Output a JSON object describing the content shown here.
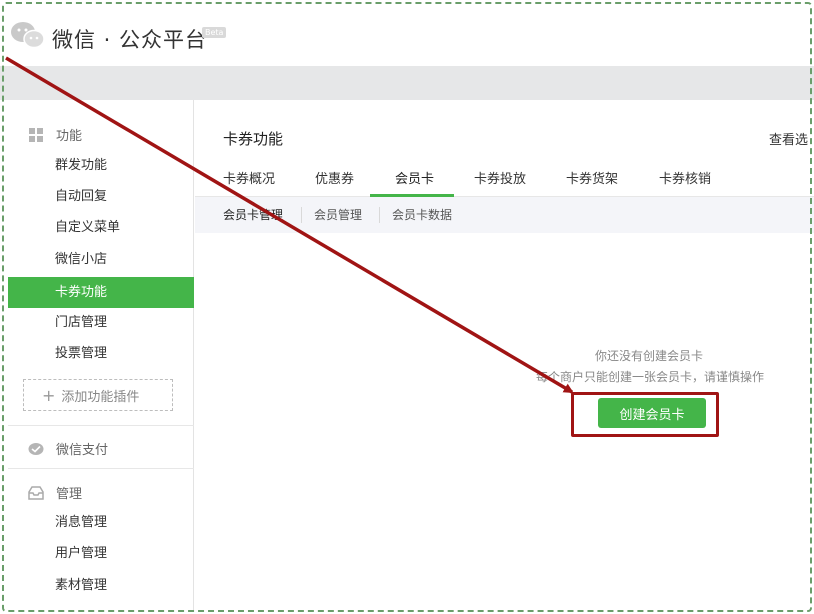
{
  "header": {
    "brand": "微信 · 公众平台",
    "beta_badge": "Beta"
  },
  "sidebar": {
    "sections": [
      {
        "label": "功能",
        "icon": "grid-icon"
      },
      {
        "label": "微信支付",
        "icon": "wechat-pay-icon"
      },
      {
        "label": "管理",
        "icon": "inbox-icon"
      }
    ],
    "function_items": [
      {
        "label": "群发功能"
      },
      {
        "label": "自动回复"
      },
      {
        "label": "自定义菜单"
      },
      {
        "label": "微信小店"
      },
      {
        "label": "卡券功能",
        "active": true
      },
      {
        "label": "门店管理"
      },
      {
        "label": "投票管理"
      }
    ],
    "add_plugin_label": "添加功能插件",
    "manage_items": [
      {
        "label": "消息管理"
      },
      {
        "label": "用户管理"
      },
      {
        "label": "素材管理"
      }
    ]
  },
  "main": {
    "title": "卡券功能",
    "view_link": "查看选",
    "tabs": [
      {
        "label": "卡券概况"
      },
      {
        "label": "优惠券"
      },
      {
        "label": "会员卡",
        "active": true
      },
      {
        "label": "卡券投放"
      },
      {
        "label": "卡券货架"
      },
      {
        "label": "卡券核销"
      }
    ],
    "subtabs": [
      {
        "label": "会员卡管理",
        "active": true
      },
      {
        "label": "会员管理"
      },
      {
        "label": "会员卡数据"
      }
    ],
    "empty_state": {
      "line1": "你还没有创建会员卡",
      "line2": "每个商户只能创建一张会员卡，请谨慎操作"
    },
    "create_button": "创建会员卡"
  },
  "colors": {
    "accent_green": "#44b549",
    "annotation_red": "#a01414",
    "topbar_gray": "#e6e7e8"
  }
}
